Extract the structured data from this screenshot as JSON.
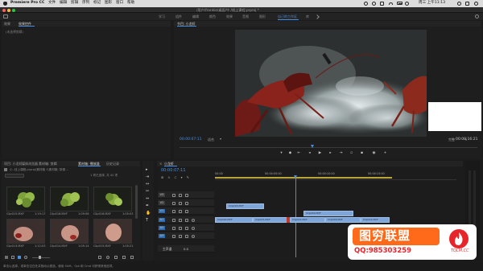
{
  "menubar": {
    "app_name": "Premiere Pro CC",
    "items": [
      "文件",
      "编辑",
      "剪辑",
      "序列",
      "标记",
      "图形",
      "窗口",
      "帮助"
    ],
    "clock": "周三 上午11:13"
  },
  "titlebar": {
    "title": "/用户/frankie/桌面/牛 /线上课程.prproj *"
  },
  "workspaces": {
    "items": [
      "学习",
      "组件",
      "编辑",
      "颜色",
      "效果",
      "音频",
      "图形",
      "自己的工作区",
      "库"
    ],
    "active_index": 7
  },
  "source_panel": {
    "tabs": [
      "效果",
      "效果控件"
    ],
    "active_tab": 1,
    "empty_text": "(未选择剪辑)"
  },
  "program": {
    "tab": "节目: 小龙虾",
    "current_timecode": "00:00:07:11",
    "duration_timecode": "00:00:16:21",
    "zoom_label": "适合",
    "quality_label": "完整"
  },
  "project": {
    "tabs": [
      "项目: 小龙虾",
      "媒体浏览器",
      "素材箱: 剪辑",
      "素材箱: 播放器",
      "历史记录"
    ],
    "active_tab": 2,
    "path": "小..线上课程.prproj\\素材箱 1\\素材箱: 剪辑 ...",
    "selection_info": "1 项已选择, 共 42 项",
    "clips": [
      {
        "name": "Clip015.MXF",
        "duration": "1:19:17"
      },
      {
        "name": "Clip016.MXF",
        "duration": "1:09:06"
      },
      {
        "name": "Clip016.MXF",
        "duration": "1:05:03"
      },
      {
        "name": "Clip013.MXF",
        "duration": "1:12:03"
      },
      {
        "name": "Clip014.MXF",
        "duration": "1:05:14"
      },
      {
        "name": "Clip015.MXF",
        "duration": "1:05:21"
      }
    ]
  },
  "timeline": {
    "tab": "小龙虾",
    "timecode": "00:00:07:11",
    "ruler": [
      "00:00",
      "00:00:05:00",
      "00:00:10:00",
      "00:00:15:00"
    ],
    "video_tracks": [
      "V3",
      "V2",
      "V1"
    ],
    "audio_tracks": [
      "A1",
      "A2",
      "A3"
    ],
    "master_label": "主声道",
    "master_value": "0.0",
    "clips_v2": [
      {
        "label": "Clip018.MXF"
      }
    ],
    "clips_v1": [
      {
        "label": "Clip016.MXF"
      },
      {
        "label": "Clip015.MXF"
      },
      {
        "label": "Clip013.MXF"
      },
      {
        "label": "Clip018.MXF"
      },
      {
        "label": "Clip012.MXF"
      }
    ],
    "clips_v1_upper": [
      {
        "label": "Clip016.MXF"
      }
    ]
  },
  "status": {
    "text": "单击以选择，或单击空白处并拖动以框选。使用 Shift、Opt 和 Cmd 可获得其他选项。"
  },
  "watermark": {
    "text": "图穷联盟",
    "qq": "QQ:985303259",
    "site": "TQLM.CC"
  },
  "colors": {
    "accent": "#4a8fe0",
    "clip_blue": "#7fa6d8",
    "logo_orange": "#ff6a1a",
    "logo_red": "#e8242b"
  }
}
